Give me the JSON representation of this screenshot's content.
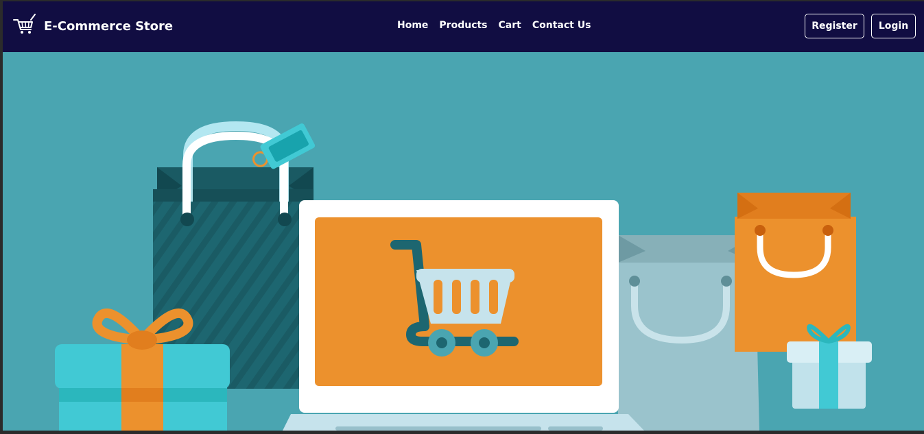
{
  "header": {
    "brand_icon": "shopping-cart-icon",
    "brand_title": "E-Commerce Store"
  },
  "nav": {
    "links": [
      "Home",
      "Products",
      "Cart",
      "Contact Us"
    ]
  },
  "auth": {
    "register_label": "Register",
    "login_label": "Login"
  },
  "hero": {
    "illustration": "shopping-illustration",
    "colors": {
      "background": "#4aa5b1",
      "navbar": "#110d42",
      "orange": "#ec912d",
      "teal_dark": "#1d6670",
      "cyan": "#41c9d4"
    }
  }
}
